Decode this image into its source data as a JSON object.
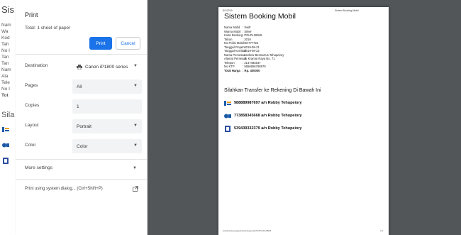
{
  "background_page": {
    "title": "Sis",
    "lines": [
      "Nam",
      "Wa",
      "Kod",
      "Tah",
      "No I",
      "Tan",
      "Tan",
      "Nam",
      "Ala",
      "Tele",
      "No I",
      "Tot"
    ],
    "subheading": "Sila"
  },
  "dialog": {
    "title": "Print",
    "subtitle": "Total: 1 sheet of paper",
    "print_label": "Print",
    "cancel_label": "Cancel",
    "accent_color": "#1a73e8",
    "settings": {
      "destination": {
        "label": "Destination",
        "value": "Canon iP1800 series"
      },
      "pages": {
        "label": "Pages",
        "value": "All"
      },
      "copies": {
        "label": "Copies",
        "value": "1"
      },
      "layout": {
        "label": "Layout",
        "value": "Portrait"
      },
      "color": {
        "label": "Color",
        "value": "Color"
      }
    },
    "more_settings": "More settings",
    "system_dialog": "Print using system dialog... (Ctrl+Shift+P)"
  },
  "preview": {
    "header_left": "8/1/2019",
    "header_right": "Sistem Booking Mobil",
    "title": "Sistem Booking Mobil",
    "details": [
      {
        "key": "Nama Mobil",
        "value": ": Swift"
      },
      {
        "key": "Warna Mobil",
        "value": ": Silver"
      },
      {
        "key": "Kode Booking",
        "value": ": POLPL28945"
      },
      {
        "key": "Tahun",
        "value": ": 2019"
      },
      {
        "key": "No Polisi Mobil",
        "value": ": DK777722"
      },
      {
        "key": "Tanggal Pinjam",
        "value": ": 2019-08-21"
      },
      {
        "key": "Tanggal Kembali",
        "value": ": 2019-08-22"
      },
      {
        "key": "Nama Pemesan",
        "value": ": Andrew Bennarrus Tehupeiory"
      },
      {
        "key": "Alamat Pemesan",
        "value": ": Jl. Kramat Raya No. 71"
      },
      {
        "key": "Telepon",
        "value": ": 2147483647"
      },
      {
        "key": "No KTP",
        "value": ": 5656656768970"
      },
      {
        "key": "Total Harga",
        "value": ": Rp. 400000"
      }
    ],
    "transfer_heading": "Silahkan Transfer ke Rekening Di Bawah Ini",
    "banks": [
      {
        "icon": "bank-icon-1",
        "text": "988889987697 a/n Robby Tehupeiory"
      },
      {
        "icon": "bank-icon-2",
        "text": "773858345668 a/n Robby Tehupeiory"
      },
      {
        "icon": "bank-icon-3",
        "text": "539439332379 a/n Robby Tehupeiory"
      }
    ],
    "footer_left": "localhost/sewa/app/print/booking.php?id=POLPL28945",
    "footer_right": "1/1"
  }
}
